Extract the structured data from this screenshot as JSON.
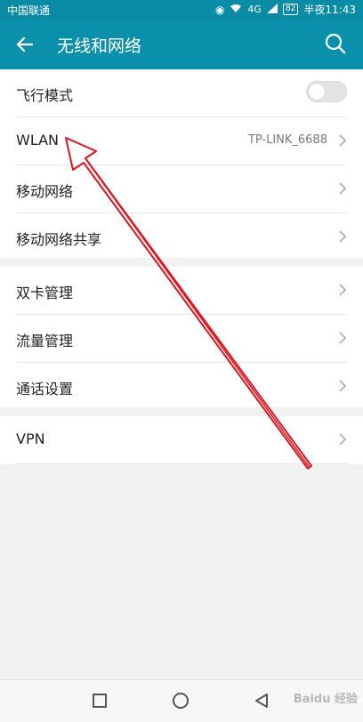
{
  "status_bar": {
    "carrier": "中国联通",
    "network": "4G",
    "battery": "82",
    "time": "半夜11:43"
  },
  "app_bar": {
    "title": "无线和网络",
    "back_icon": "arrow-left-icon",
    "search_icon": "search-icon"
  },
  "groups": [
    {
      "items": [
        {
          "label": "飞行模式",
          "type": "toggle",
          "state": "off"
        },
        {
          "label": "WLAN",
          "value": "TP-LINK_6688"
        },
        {
          "label": "移动网络"
        },
        {
          "label": "移动网络共享"
        }
      ]
    },
    {
      "items": [
        {
          "label": "双卡管理"
        },
        {
          "label": "流量管理"
        },
        {
          "label": "通话设置"
        }
      ]
    },
    {
      "items": [
        {
          "label": "VPN"
        }
      ]
    }
  ],
  "watermark": "Baidu 经验",
  "colors": {
    "accent": "#0b90ab",
    "annotation_arrow": "#e0141d"
  }
}
